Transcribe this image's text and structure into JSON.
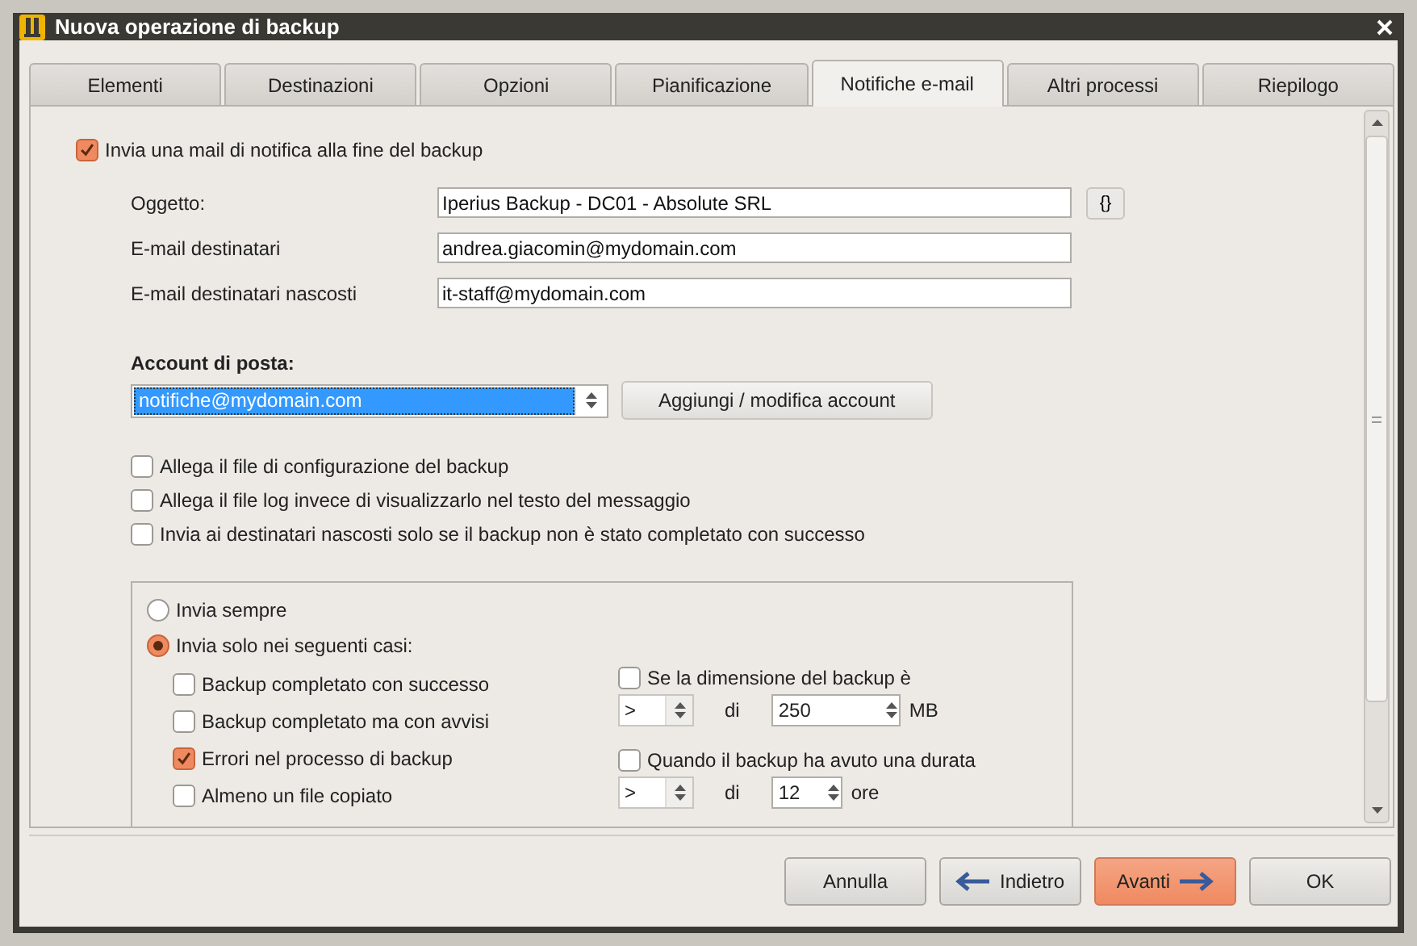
{
  "window": {
    "title": "Nuova operazione di backup"
  },
  "tabs": [
    {
      "label": "Elementi",
      "selected": false
    },
    {
      "label": "Destinazioni",
      "selected": false
    },
    {
      "label": "Opzioni",
      "selected": false
    },
    {
      "label": "Pianificazione",
      "selected": false
    },
    {
      "label": "Notifiche e-mail",
      "selected": true
    },
    {
      "label": "Altri processi",
      "selected": false
    },
    {
      "label": "Riepilogo",
      "selected": false
    }
  ],
  "notify": {
    "label": "Invia una mail di notifica alla fine del backup",
    "checked": true
  },
  "fields": [
    {
      "label": "Oggetto:",
      "value": "Iperius Backup - DC01 - Absolute SRL",
      "button": "{}"
    },
    {
      "label": "E-mail destinatari",
      "value": "andrea.giacomin@mydomain.com"
    },
    {
      "label": "E-mail destinatari nascosti",
      "value": "it-staff@mydomain.com"
    }
  ],
  "account": {
    "label": "Account di posta:",
    "value": "notifiche@mydomain.com",
    "button": "Aggiungi / modifica account"
  },
  "options": [
    {
      "label": "Allega il file di configurazione del backup",
      "checked": false
    },
    {
      "label": "Allega il file log invece di visualizzarlo nel testo del messaggio",
      "checked": false
    },
    {
      "label": "Invia ai destinatari nascosti solo se il backup non è stato completato con successo",
      "checked": false
    }
  ],
  "send_mode": [
    {
      "label": "Invia sempre",
      "selected": false
    },
    {
      "label": "Invia solo nei seguenti casi:",
      "selected": true
    }
  ],
  "conditions": [
    {
      "label": "Backup completato con successo",
      "checked": false
    },
    {
      "label": "Backup completato ma con avvisi",
      "checked": false
    },
    {
      "label": "Errori nel processo di backup",
      "checked": true
    },
    {
      "label": "Almeno un file copiato",
      "checked": false
    }
  ],
  "thresholds": [
    {
      "label": "Se la dimensione del backup è",
      "checked": false,
      "operator": ">",
      "di": "di",
      "value": "250",
      "unit": "MB"
    },
    {
      "label": "Quando il backup ha avuto una durata",
      "checked": false,
      "operator": ">",
      "di": "di",
      "value": "12",
      "unit": "ore"
    }
  ],
  "buttons": [
    {
      "label": "Annulla",
      "kind": "plain",
      "primary": false
    },
    {
      "label": "Indietro",
      "kind": "back",
      "primary": false
    },
    {
      "label": "Avanti",
      "kind": "next",
      "primary": true
    },
    {
      "label": "OK",
      "kind": "plain",
      "primary": false
    }
  ]
}
